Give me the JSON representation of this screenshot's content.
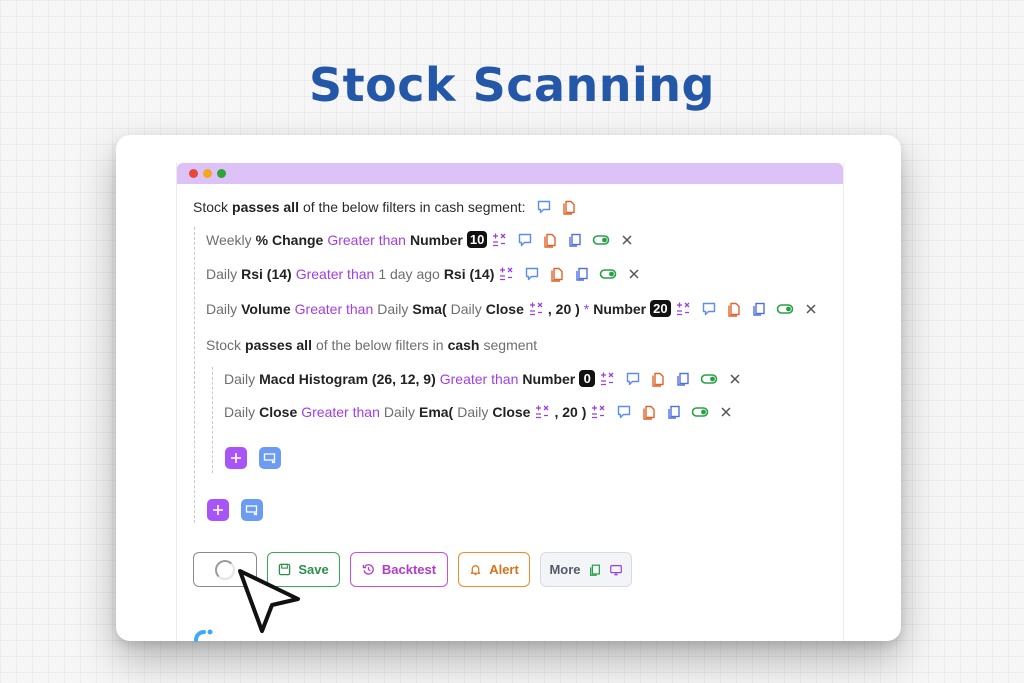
{
  "page": {
    "title": "Stock Scanning"
  },
  "scanner": {
    "root": {
      "prefix": "Stock",
      "passes": "passes all",
      "suffix": "of the below filters in cash segment:"
    },
    "filters": [
      {
        "parts": [
          {
            "t": "Weekly",
            "s": "muted"
          },
          {
            "t": "% Change",
            "s": "bold"
          },
          {
            "t": "Greater than",
            "s": "purple"
          },
          {
            "t": "Number",
            "s": "bold"
          }
        ],
        "badge": "10"
      },
      {
        "parts": [
          {
            "t": "Daily",
            "s": "muted"
          },
          {
            "t": "Rsi (14)",
            "s": "bold"
          },
          {
            "t": "Greater than",
            "s": "purple"
          },
          {
            "t": "1 day ago",
            "s": "muted"
          },
          {
            "t": "Rsi (14)",
            "s": "bold"
          }
        ]
      },
      {
        "parts": [
          {
            "t": "Daily",
            "s": "muted"
          },
          {
            "t": "Volume",
            "s": "bold"
          },
          {
            "t": "Greater than",
            "s": "purple"
          },
          {
            "t": "Daily",
            "s": "muted"
          },
          {
            "t": "Sma(",
            "s": "bold"
          },
          {
            "t": "Daily",
            "s": "muted"
          },
          {
            "t": "Close",
            "s": "bold"
          },
          {
            "t": "±",
            "s": "op"
          },
          {
            "t": ", 20 )",
            "s": "bold"
          },
          {
            "t": "*",
            "s": "purple"
          },
          {
            "t": "Number",
            "s": "bold"
          }
        ],
        "badge": "20"
      }
    ],
    "subgroup": {
      "prefix": "Stock",
      "passes": "passes all",
      "middle": "of the below filters in",
      "segment": "cash",
      "suffix": "segment"
    },
    "sub_filters": [
      {
        "parts": [
          {
            "t": "Daily",
            "s": "muted"
          },
          {
            "t": "Macd Histogram (26, 12, 9)",
            "s": "bold"
          },
          {
            "t": "Greater than",
            "s": "purple"
          },
          {
            "t": "Number",
            "s": "bold"
          }
        ],
        "badge": "0"
      },
      {
        "parts": [
          {
            "t": "Daily",
            "s": "muted"
          },
          {
            "t": "Close",
            "s": "bold"
          },
          {
            "t": "Greater than",
            "s": "purple"
          },
          {
            "t": "Daily",
            "s": "muted"
          },
          {
            "t": "Ema(",
            "s": "bold"
          },
          {
            "t": "Daily",
            "s": "muted"
          },
          {
            "t": "Close",
            "s": "bold"
          },
          {
            "t": "±",
            "s": "op"
          },
          {
            "t": ", 20 )",
            "s": "bold"
          }
        ]
      }
    ]
  },
  "actions": {
    "save": "Save",
    "backtest": "Backtest",
    "alert": "Alert",
    "more": "More"
  },
  "colors": {
    "title": "#2457a8",
    "titlebar": "#dcc2f7",
    "purple": "#a23ee6",
    "comment": "#5b8def",
    "copy": "#e0632a",
    "duplicate": "#4f6fe0",
    "toggle": "#27a046"
  }
}
